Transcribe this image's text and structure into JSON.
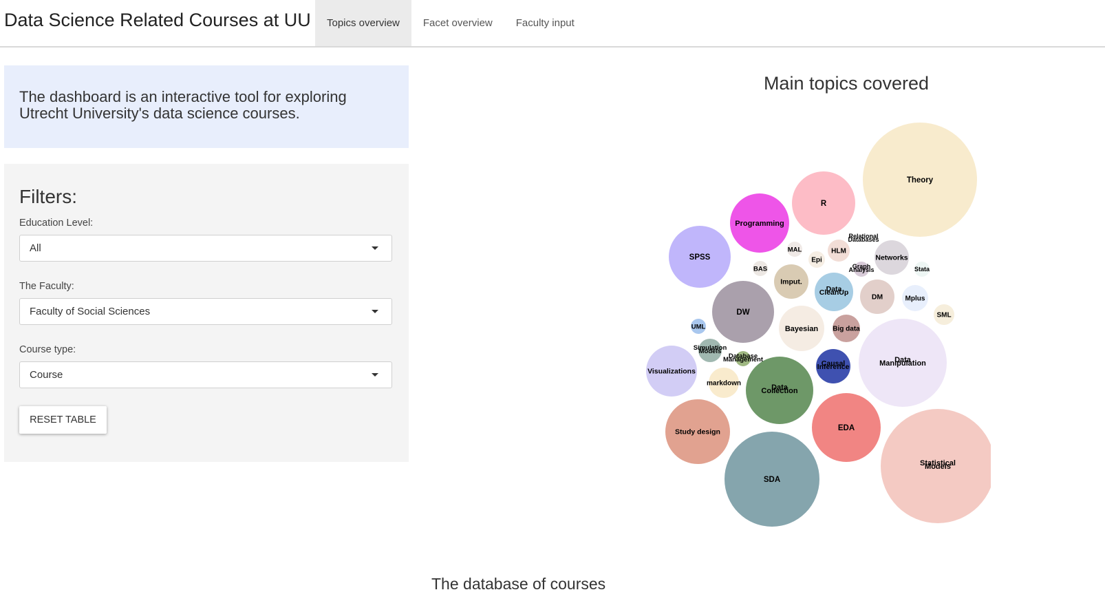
{
  "header": {
    "brand": "Data Science Related Courses at UU",
    "tabs": [
      {
        "label": "Topics overview",
        "active": true
      },
      {
        "label": "Facet overview",
        "active": false
      },
      {
        "label": "Faculty input",
        "active": false
      }
    ]
  },
  "intro": {
    "text": "The dashboard is an interactive tool for exploring Utrecht University's data science courses."
  },
  "filters": {
    "heading": "Filters:",
    "education_level": {
      "label": "Education Level:",
      "value": "All"
    },
    "faculty": {
      "label": "The Faculty:",
      "value": "Faculty of Social Sciences"
    },
    "course_type": {
      "label": "Course type:",
      "value": "Course"
    },
    "reset_label": "RESET TABLE"
  },
  "bubble_chart": {
    "title": "Main topics covered",
    "bubbles": [
      {
        "label": "Theory",
        "color": "#f8ebcd"
      },
      {
        "label": "R",
        "color": "#fdbcc6"
      },
      {
        "label": "Programming",
        "color": "#ee55e8"
      },
      {
        "label": "SPSS",
        "color": "#c0b6fb"
      },
      {
        "label": "MAL",
        "color": "#efe9e6"
      },
      {
        "label": "HLM",
        "color": "#f2ddd6"
      },
      {
        "label": "Relational Databases",
        "color": "#ffffff"
      },
      {
        "label": "Networks",
        "color": "#dcd7dd"
      },
      {
        "label": "Epi",
        "color": "#f6eee4"
      },
      {
        "label": "BAS",
        "color": "#ece7e3"
      },
      {
        "label": "Graph Analysis",
        "color": "#d8cbd8"
      },
      {
        "label": "Stata",
        "color": "#eef6f4"
      },
      {
        "label": "Imput.",
        "color": "#d9cbb3"
      },
      {
        "label": "Data CleanUp",
        "color": "#a7cde4"
      },
      {
        "label": "DM",
        "color": "#e2cfca"
      },
      {
        "label": "Mplus",
        "color": "#e8effc"
      },
      {
        "label": "DW",
        "color": "#aaa0ac"
      },
      {
        "label": "UML",
        "color": "#a9c7ee"
      },
      {
        "label": "Bayesian",
        "color": "#f5ece3"
      },
      {
        "label": "Big data",
        "color": "#c9a19e"
      },
      {
        "label": "SML",
        "color": "#f6eedc"
      },
      {
        "label": "Simulation Models",
        "color": "#a0b8b0"
      },
      {
        "label": "Database Management",
        "color": "#9fb882"
      },
      {
        "label": "Data Manipulation",
        "color": "#eee6f7"
      },
      {
        "label": "Visualizations",
        "color": "#d2cdf5"
      },
      {
        "label": "Causal Inference",
        "color": "#3f51b0"
      },
      {
        "label": "markdown",
        "color": "#f9ebcd"
      },
      {
        "label": "Data Collection",
        "color": "#6e9868"
      },
      {
        "label": "Study design",
        "color": "#e1a290"
      },
      {
        "label": "EDA",
        "color": "#f18583"
      },
      {
        "label": "Statistical Models",
        "color": "#f4cac3"
      },
      {
        "label": "SDA",
        "color": "#85a5ad"
      }
    ]
  },
  "database": {
    "title": "The database of courses"
  }
}
